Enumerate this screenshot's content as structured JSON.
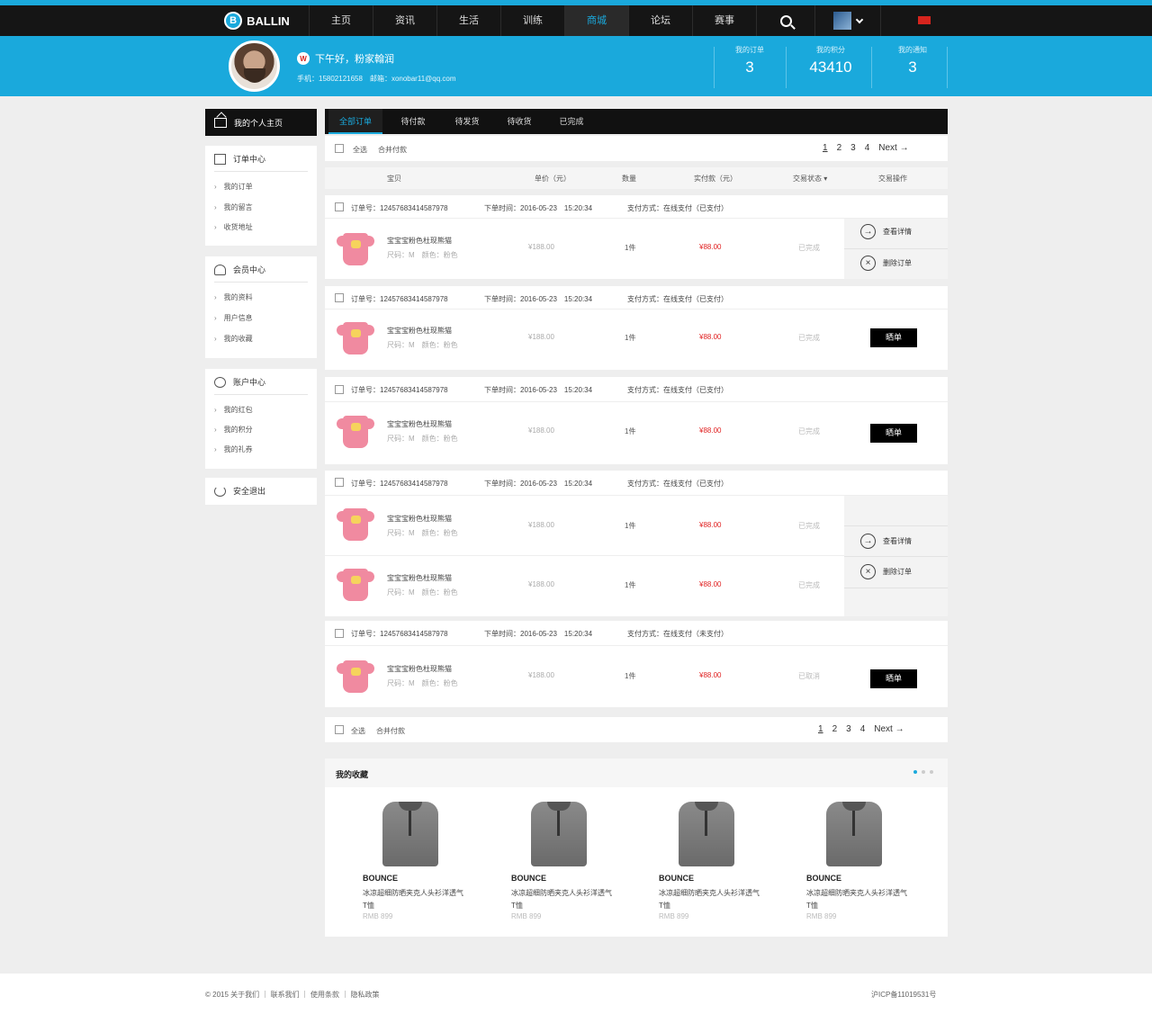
{
  "nav": {
    "brand": "BALLIN",
    "brand_mark": "B",
    "items": [
      "主页",
      "资讯",
      "生活",
      "训练",
      "商城",
      "论坛",
      "赛事"
    ],
    "active_index": 4
  },
  "profile": {
    "greeting_icon": "W",
    "greeting": "下午好，粉家翰润",
    "contact": "手机：15802121658　邮箱：xonobar11@qq.com",
    "stats": [
      {
        "label": "我的订单",
        "value": "3"
      },
      {
        "label": "我的积分",
        "value": "43410"
      },
      {
        "label": "我的通知",
        "value": "3"
      }
    ]
  },
  "sidebar": {
    "home": "我的个人主页",
    "groups": [
      {
        "title": "订单中心",
        "links": [
          "我的订单",
          "我的留言",
          "收货地址"
        ]
      },
      {
        "title": "会员中心",
        "links": [
          "我的资料",
          "用户信息",
          "我的收藏"
        ]
      },
      {
        "title": "账户中心",
        "links": [
          "我的红包",
          "我的积分",
          "我的礼券"
        ]
      }
    ],
    "logout": "安全退出"
  },
  "tabs": [
    "全部订单",
    "待付款",
    "待发货",
    "待收货",
    "已完成"
  ],
  "toolbar": {
    "select_all": "全选",
    "merge_pay": "合并付款",
    "pages": [
      "1",
      "2",
      "3",
      "4"
    ],
    "next": "Next →"
  },
  "columns": [
    "宝贝",
    "单价（元）",
    "数量",
    "实付款（元）",
    "交易状态 ▾",
    "交易操作"
  ],
  "orders": [
    {
      "no": "订单号：12457683414587978",
      "time": "下单时间：2016-05-23　15:20:34",
      "pay": "支付方式：在线支付（已支付）",
      "items": [
        {
          "name": "宝宝宝粉色杜现熊猫",
          "attr": "尺码：M　颜色：粉色",
          "price": "¥188.00",
          "qty": "1件",
          "paid": "¥88.00",
          "status": "已完成"
        }
      ],
      "actions": [
        "查看详情",
        "删除订单"
      ]
    },
    {
      "no": "订单号：12457683414587978",
      "time": "下单时间：2016-05-23　15:20:34",
      "pay": "支付方式：在线支付（已支付）",
      "items": [
        {
          "name": "宝宝宝粉色杜现熊猫",
          "attr": "尺码：M　颜色：粉色",
          "price": "¥188.00",
          "qty": "1件",
          "paid": "¥88.00",
          "status": "已完成"
        }
      ],
      "button": "晒单"
    },
    {
      "no": "订单号：12457683414587978",
      "time": "下单时间：2016-05-23　15:20:34",
      "pay": "支付方式：在线支付（已支付）",
      "items": [
        {
          "name": "宝宝宝粉色杜现熊猫",
          "attr": "尺码：M　颜色：粉色",
          "price": "¥188.00",
          "qty": "1件",
          "paid": "¥88.00",
          "status": "已完成"
        }
      ],
      "button": "晒单"
    },
    {
      "no": "订单号：12457683414587978",
      "time": "下单时间：2016-05-23　15:20:34",
      "pay": "支付方式：在线支付（已支付）",
      "items": [
        {
          "name": "宝宝宝粉色杜现熊猫",
          "attr": "尺码：M　颜色：粉色",
          "price": "¥188.00",
          "qty": "1件",
          "paid": "¥88.00",
          "status": "已完成"
        },
        {
          "name": "宝宝宝粉色杜现熊猫",
          "attr": "尺码：M　颜色：粉色",
          "price": "¥188.00",
          "qty": "1件",
          "paid": "¥88.00",
          "status": "已完成"
        }
      ],
      "actions": [
        "查看详情",
        "删除订单"
      ]
    },
    {
      "no": "订单号：12457683414587978",
      "time": "下单时间：2016-05-23　15:20:34",
      "pay": "支付方式：在线支付（未支付）",
      "items": [
        {
          "name": "宝宝宝粉色杜现熊猫",
          "attr": "尺码：M　颜色：粉色",
          "price": "¥188.00",
          "qty": "1件",
          "paid": "¥88.00",
          "status": "已取消"
        }
      ],
      "button": "晒单"
    }
  ],
  "favorites": {
    "title": "我的收藏",
    "items": [
      {
        "brand": "BOUNCE",
        "desc": "冰凉超细防晒夹克人头衫洋透气",
        "desc2": "T恤",
        "price": "RMB 899"
      },
      {
        "brand": "BOUNCE",
        "desc": "冰凉超细防晒夹克人头衫洋透气",
        "desc2": "T恤",
        "price": "RMB 899"
      },
      {
        "brand": "BOUNCE",
        "desc": "冰凉超细防晒夹克人头衫洋透气",
        "desc2": "T恤",
        "price": "RMB 899"
      },
      {
        "brand": "BOUNCE",
        "desc": "冰凉超细防晒夹克人头衫洋透气",
        "desc2": "T恤",
        "price": "RMB 899"
      }
    ]
  },
  "footer": {
    "left": "© 2015 关于我们 ｜ 联系我们 ｜ 使用条款 ｜ 隐私政策",
    "right": "沪ICP备11019531号"
  },
  "colors": {
    "accent": "#1aa9dc",
    "nav": "#151515",
    "price": "#e02020"
  }
}
